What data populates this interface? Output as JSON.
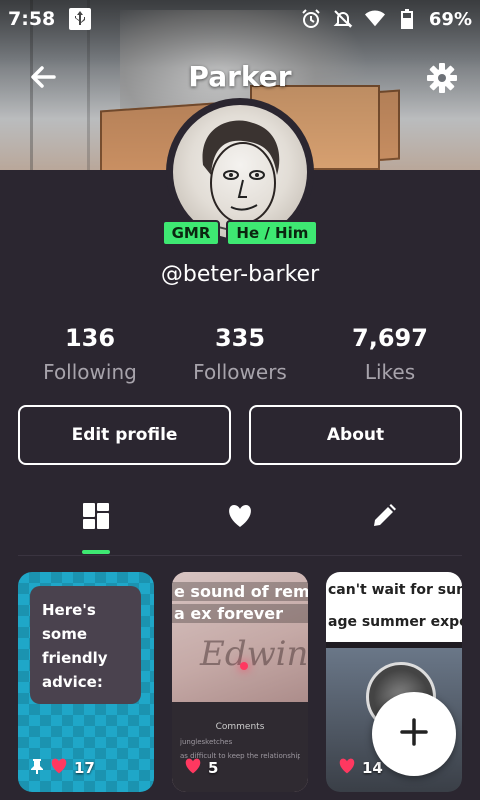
{
  "status_bar": {
    "time": "7:58",
    "battery": "69%",
    "icons": [
      "usb-icon",
      "alarm-icon",
      "notifications-off-icon",
      "wifi-icon",
      "battery-icon"
    ]
  },
  "header": {
    "title": "Parker",
    "back_icon": "arrow-left-icon",
    "settings_icon": "gear-icon"
  },
  "profile": {
    "badges": [
      "GMR",
      "He / Him"
    ],
    "handle": "@beter-barker",
    "badge_color": "#3ee872"
  },
  "stats": [
    {
      "value": "136",
      "label": "Following"
    },
    {
      "value": "335",
      "label": "Followers"
    },
    {
      "value": "7,697",
      "label": "Likes"
    }
  ],
  "actions": {
    "edit_label": "Edit profile",
    "about_label": "About"
  },
  "tabs": [
    {
      "icon": "grid-icon",
      "selected": true
    },
    {
      "icon": "heart-icon",
      "selected": false
    },
    {
      "icon": "pencil-icon",
      "selected": false
    }
  ],
  "posts": [
    {
      "note": "Here's some friendly advice:",
      "likes": "17",
      "pinned": true
    },
    {
      "caption1": "e sound of remov",
      "caption2": "a ex forever",
      "comments_header": "Comments",
      "comment_user": "junglesketches",
      "comment_text": "as difficult to keep the relationship",
      "likes": "5"
    },
    {
      "caption1": "can't wait for summ",
      "caption2": "age summer experi",
      "likes": "14"
    }
  ],
  "accent_color": "#3ee872",
  "like_color": "#ff3860"
}
